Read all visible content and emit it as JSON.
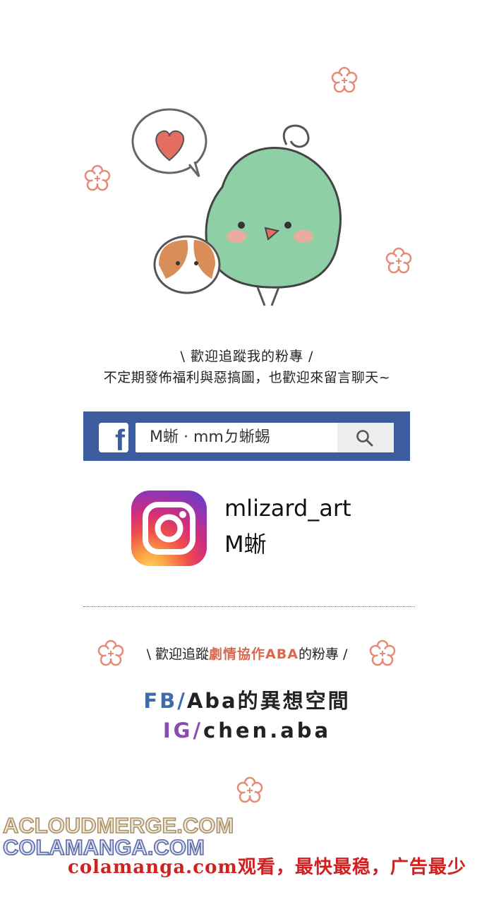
{
  "intro": {
    "line1": "\\ 歡迎追蹤我的粉專 /",
    "line2": "不定期發佈福利與惡搞圖，也歡迎來留言聊天~"
  },
  "facebook": {
    "logo_letter": "f",
    "search_text": "M蜥 · mmㄉ蜥蜴",
    "brand_color": "#3b5c9f",
    "icons": [
      "facebook-logo-icon",
      "search-icon"
    ]
  },
  "instagram": {
    "handle": "mlizard_art",
    "name": "M蜥",
    "icon": "instagram-logo-icon"
  },
  "aba": {
    "pre": "\\ 歡迎追蹤",
    "highlight": "劇情協作ABA",
    "post": "的粉專 /",
    "highlight_color": "#d9684f",
    "fb_prefix": "FB/",
    "fb_text": "Aba的異想空間",
    "ig_prefix": "IG/",
    "ig_text": "chen.aba"
  },
  "watermarks": {
    "line1": "ACLOUDMERGE.COM",
    "line2": "COLAMANGA.COM",
    "line3": "colamanga.com观看，最快最稳，广告最少"
  }
}
